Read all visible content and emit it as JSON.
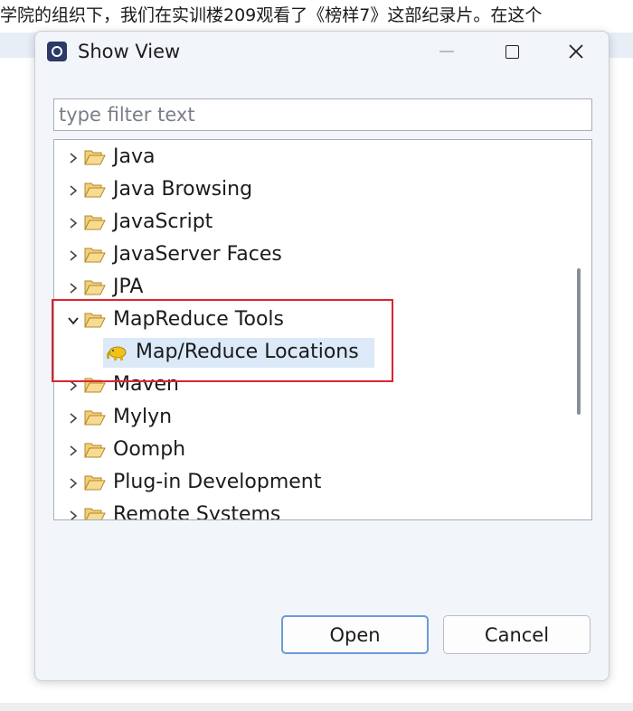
{
  "background": {
    "text": "学院的组织下，我们在实训楼209观看了《榜样7》这部纪录片。在这个"
  },
  "dialog": {
    "title": "Show View",
    "filter_placeholder": "type filter text",
    "tree_items": [
      {
        "label": "Java",
        "expanded": false
      },
      {
        "label": "Java Browsing",
        "expanded": false
      },
      {
        "label": "JavaScript",
        "expanded": false
      },
      {
        "label": "JavaServer Faces",
        "expanded": false
      },
      {
        "label": "JPA",
        "expanded": false
      },
      {
        "label": "MapReduce Tools",
        "expanded": true,
        "children": [
          {
            "label": "Map/Reduce Locations",
            "selected": true
          }
        ]
      },
      {
        "label": "Maven",
        "expanded": false
      },
      {
        "label": "Mylyn",
        "expanded": false
      },
      {
        "label": "Oomph",
        "expanded": false
      },
      {
        "label": "Plug-in Development",
        "expanded": false
      },
      {
        "label": "Remote Systems",
        "expanded": false
      }
    ],
    "buttons": {
      "open": "Open",
      "cancel": "Cancel"
    }
  },
  "colors": {
    "highlight": "#d9262e",
    "selection": "#dbe9f8",
    "folder": "#e8b84a",
    "default_button_border": "#6b9bd8"
  },
  "icons": {
    "folder": "folder-open-icon",
    "chevron_collapsed": "chevron-right-icon",
    "chevron_expanded": "chevron-down-icon",
    "view": "elephant-icon"
  }
}
